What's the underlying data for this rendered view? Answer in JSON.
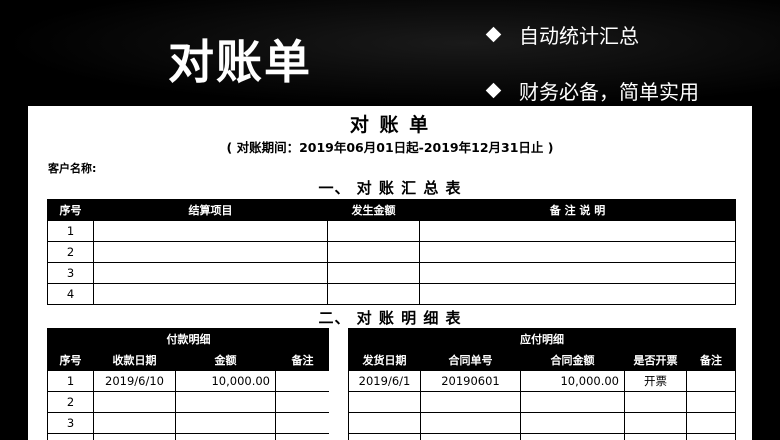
{
  "banner": {
    "title": "对账单",
    "bullets": [
      "自动统计汇总",
      "财务必备，简单实用"
    ]
  },
  "document": {
    "title": "对 账 单",
    "period": "( 对账期间：2019年06月01日起-2019年12月31日止 )",
    "customer_label": "客户名称:",
    "summary_section_title": "一、 对 账 汇 总 表",
    "summary_table": {
      "headers": [
        "序号",
        "结算项目",
        "发生金额",
        "备 注 说 明"
      ],
      "rows": [
        [
          "1",
          "",
          "",
          ""
        ],
        [
          "2",
          "",
          "",
          ""
        ],
        [
          "3",
          "",
          "",
          ""
        ],
        [
          "4",
          "",
          "",
          ""
        ]
      ]
    },
    "detail_section_title": "二、 对 账 明 细 表",
    "payment_table": {
      "group_header": "付款明细",
      "headers": [
        "序号",
        "收款日期",
        "金额",
        "备注"
      ],
      "rows": [
        [
          "1",
          "2019/6/10",
          "10,000.00",
          ""
        ],
        [
          "2",
          "",
          "",
          ""
        ],
        [
          "3",
          "",
          "",
          ""
        ],
        [
          "",
          "",
          "",
          ""
        ]
      ]
    },
    "receivable_table": {
      "group_header": "应付明细",
      "headers": [
        "发货日期",
        "合同单号",
        "合同金额",
        "是否开票",
        "备注"
      ],
      "rows": [
        [
          "2019/6/1",
          "20190601",
          "10,000.00",
          "开票",
          ""
        ],
        [
          "",
          "",
          "",
          "",
          ""
        ],
        [
          "",
          "",
          "",
          "",
          ""
        ],
        [
          "",
          "",
          "",
          "",
          ""
        ]
      ]
    }
  }
}
